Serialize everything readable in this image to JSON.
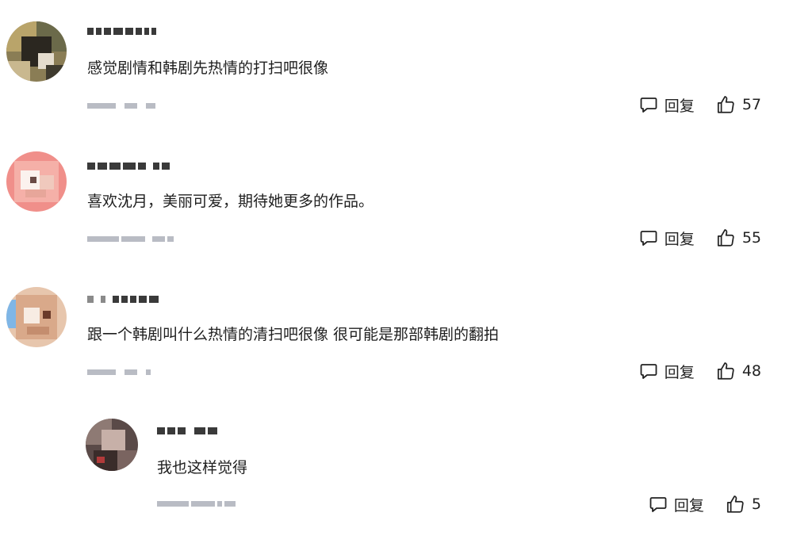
{
  "comments": [
    {
      "avatar": "user-avatar",
      "text": "感觉剧情和韩剧先热情的打扫吧很像",
      "reply_label": "回复",
      "likes": "57"
    },
    {
      "avatar": "user-avatar",
      "text": "喜欢沈月，美丽可爱，期待她更多的作品。",
      "reply_label": "回复",
      "likes": "55"
    },
    {
      "avatar": "user-avatar",
      "text": "跟一个韩剧叫什么热情的清扫吧很像 很可能是那部韩剧的翻拍",
      "reply_label": "回复",
      "likes": "48"
    }
  ],
  "reply": {
    "avatar": "user-avatar",
    "text": "我也这样觉得",
    "reply_label": "回复",
    "likes": "5"
  },
  "icons": {
    "reply": "comment-bubble-icon",
    "like": "thumbs-up-icon"
  },
  "colors": {
    "text": "#1f1f1f",
    "muted": "#b9bcc4"
  }
}
